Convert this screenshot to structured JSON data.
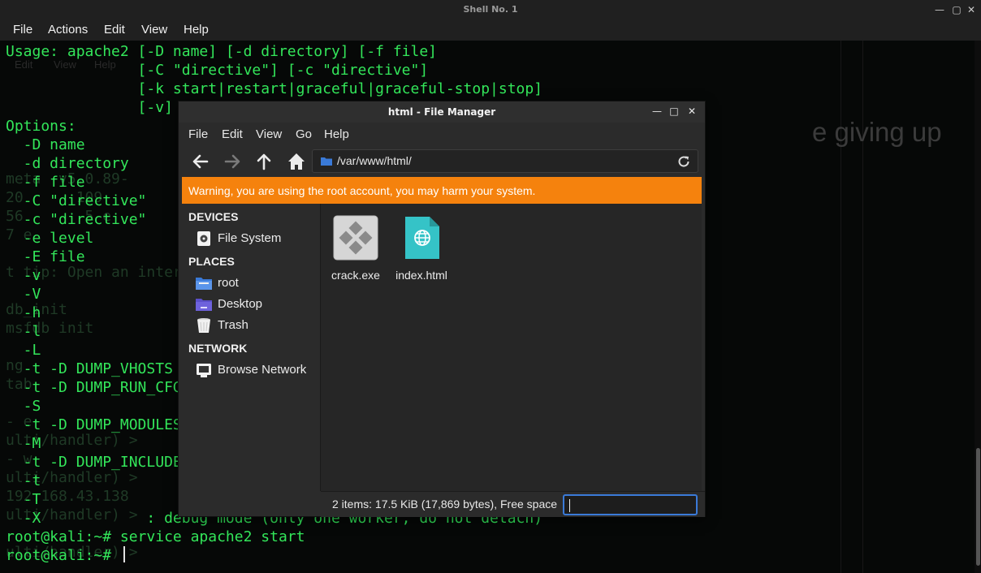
{
  "terminal": {
    "window_title": "Shell No. 1",
    "menu": [
      "File",
      "Actions",
      "Edit",
      "View",
      "Help"
    ],
    "lines": [
      "Usage: apache2 [-D name] [-d directory] [-f file]",
      "               [-C \"directive\"] [-c \"directive\"]",
      "               [-k start|restart|graceful|graceful-stop|stop]",
      "               [-v]",
      "Options:",
      "  -D name",
      "  -d directory",
      "  -f file",
      "  -C \"directive\"",
      "  -c \"directive\"",
      "  -e level",
      "  -E file",
      "  -v",
      "  -V",
      "  -h",
      "  -l",
      "  -L",
      "  -t -D DUMP_VHOSTS",
      "  -t -D DUMP_RUN_CFG",
      "  -S",
      "  -t -D DUMP_MODULES",
      "  -M",
      "  -t -D DUMP_INCLUDES",
      "  -t",
      "  -T",
      "  -X            : debug mode (only one worker, do not detach)",
      "root@kali:~# service apache2 start",
      "root@kali:~# "
    ],
    "background_text": {
      "menu": [
        "Edit",
        "View",
        "Help"
      ],
      "ghost_lines": [
        "meta  v5.0.89-",
        "20      109",
        "56       5 e",
        "7 e",
        "t tip: Open an inter",
        "db_init",
        "msfdb init",
        "ng  ",
        "tab  ",
        "- e",
        "ulti/handler) >",
        "- w",
        "ulti/handler) >",
        "192.168.43.138",
        "ulti/handler) >",
        "ulti/handler) >"
      ],
      "side_phrase": "e giving up"
    }
  },
  "file_manager": {
    "title": "html - File Manager",
    "menu": [
      "File",
      "Edit",
      "View",
      "Go",
      "Help"
    ],
    "toolbar": {
      "back_icon": "arrow-left-icon",
      "forward_icon": "arrow-right-icon",
      "up_icon": "arrow-up-icon",
      "home_icon": "home-icon"
    },
    "location": "/var/www/html/",
    "warning": "Warning, you are using the root account, you may harm your system.",
    "sidebar": {
      "devices_header": "DEVICES",
      "devices": [
        {
          "label": "File System",
          "icon": "drive-icon"
        }
      ],
      "places_header": "PLACES",
      "places": [
        {
          "label": "root",
          "icon": "folder-icon"
        },
        {
          "label": "Desktop",
          "icon": "desktop-folder-icon"
        },
        {
          "label": "Trash",
          "icon": "trash-icon"
        }
      ],
      "network_header": "NETWORK",
      "network": [
        {
          "label": "Browse Network",
          "icon": "network-icon"
        }
      ]
    },
    "files": [
      {
        "name": "crack.exe",
        "icon": "executable-icon"
      },
      {
        "name": "index.html",
        "icon": "html-file-icon"
      }
    ],
    "status_text": "2 items: 17.5 KiB (17,869 bytes), Free space",
    "rename_value": "",
    "colors": {
      "warning": "#f5820d",
      "terminal_text": "#33e65a",
      "focus": "#3a7ad8",
      "html_icon": "#35c3c7"
    }
  }
}
